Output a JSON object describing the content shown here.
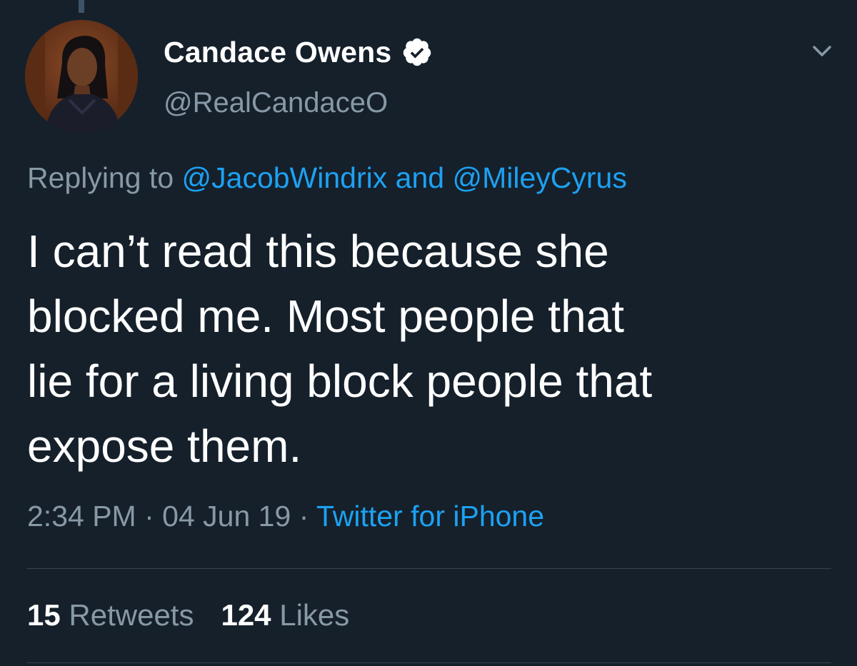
{
  "tweet": {
    "author": {
      "display_name": "Candace Owens",
      "handle": "@RealCandaceO",
      "verified": true,
      "verified_icon": "verified-badge-icon",
      "avatar_icon": "profile-photo"
    },
    "menu_icon": "chevron-down-icon",
    "reply_to": {
      "prefix": "Replying to",
      "mention_1": "@JacobWindrix",
      "joiner": "and",
      "mention_2": "@MileyCyrus"
    },
    "text": "I can’t read this because she\nblocked me. Most people that\nlie for a living block people that\nexpose them.",
    "meta": {
      "time": "2:34 PM",
      "separator_1": "·",
      "date": "04 Jun 19",
      "separator_2": "·",
      "source": "Twitter for iPhone"
    },
    "stats": {
      "retweets_count": "15",
      "retweets_label": "Retweets",
      "likes_count": "124",
      "likes_label": "Likes"
    }
  },
  "colors": {
    "background": "#15202b",
    "primary_text": "#ffffff",
    "secondary_text": "#8899a6",
    "accent": "#1da1f2",
    "divider": "#38444d"
  }
}
